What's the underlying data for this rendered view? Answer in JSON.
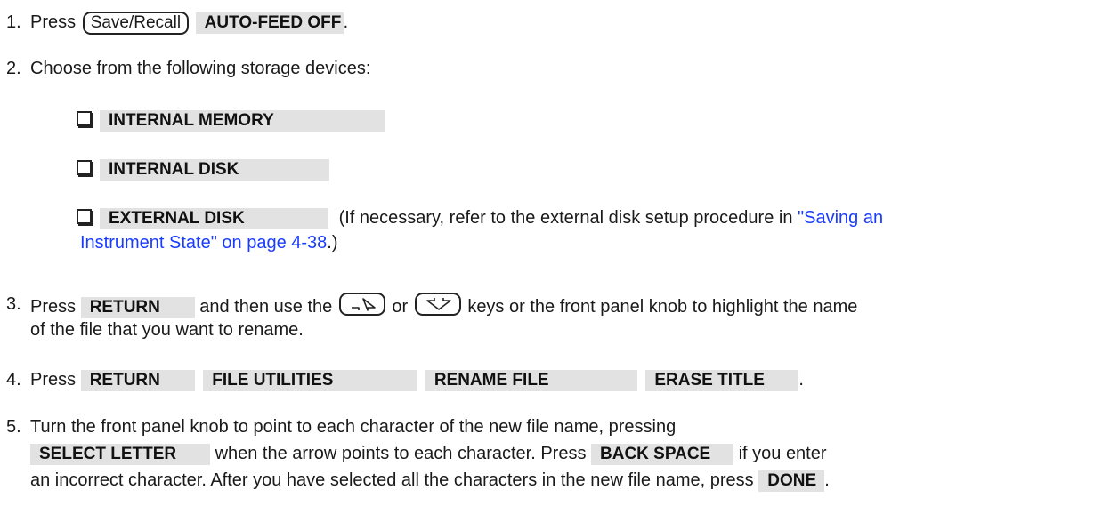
{
  "step1": {
    "number": "1.",
    "press": "Press",
    "hardkey": "Save/Recall",
    "softkey": "AUTO-FEED OFF",
    "end": "."
  },
  "step2": {
    "number": "2.",
    "text": "Choose from the following storage devices:",
    "options": [
      {
        "softkey": "INTERNAL MEMORY"
      },
      {
        "softkey": "INTERNAL DISK"
      },
      {
        "softkey": "EXTERNAL DISK",
        "note_pre": "(If necessary, refer to the external disk setup procedure in ",
        "link_line1": "\"Saving an",
        "link_line2": "Instrument State\" on page 4-38",
        "note_post": ".)"
      }
    ]
  },
  "step3": {
    "number": "3.",
    "press": "Press",
    "softkey": "RETURN",
    "text_a": "and then use the",
    "text_or": "or",
    "text_b": "keys or the front panel knob to highlight the name",
    "line2": "of the file that you want to rename.",
    "up_arrow_icon": "up-arrow-key-icon",
    "down_arrow_icon": "down-arrow-key-icon"
  },
  "step4": {
    "number": "4.",
    "press": "Press",
    "softkeys": [
      "RETURN",
      "FILE UTILITIES",
      "RENAME FILE",
      "ERASE TITLE"
    ],
    "end": "."
  },
  "step5": {
    "number": "5.",
    "line1": "Turn the front panel knob to point to each character of the new file name, pressing",
    "softkey_select": "SELECT LETTER",
    "text_a": "when the arrow points to each character. Press",
    "softkey_back": "BACK SPACE",
    "text_b": "if you enter",
    "line3": "an incorrect character. After you have selected all the characters in the new file name, press",
    "softkey_done": "DONE",
    "end": "."
  }
}
